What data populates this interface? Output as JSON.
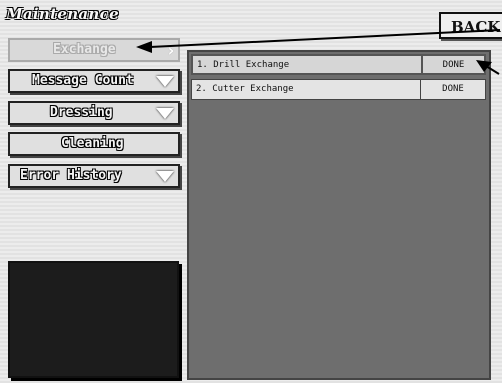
{
  "window": {
    "title": "Maintenance"
  },
  "back_button": {
    "label": "BACK"
  },
  "menu": [
    {
      "label": "Exchange",
      "state": "disabled"
    },
    {
      "label": "Message Count",
      "state": "enabled"
    },
    {
      "label": "Dressing",
      "state": "enabled"
    },
    {
      "label": "Cleaning",
      "state": "enabled"
    },
    {
      "label": "Error History",
      "state": "enabled"
    }
  ],
  "exchange_list": [
    {
      "name": "1. Drill Exchange",
      "status": "DONE"
    },
    {
      "name": "2. Cutter Exchange",
      "status": "DONE"
    }
  ],
  "colors": {
    "panel": "#6e6e6e",
    "display": "#1c1c1c",
    "annotation": "#000000"
  },
  "icons": [
    "dropdown-triangle-icon",
    "chevron-right-icon",
    "annotation-arrow-icon"
  ]
}
